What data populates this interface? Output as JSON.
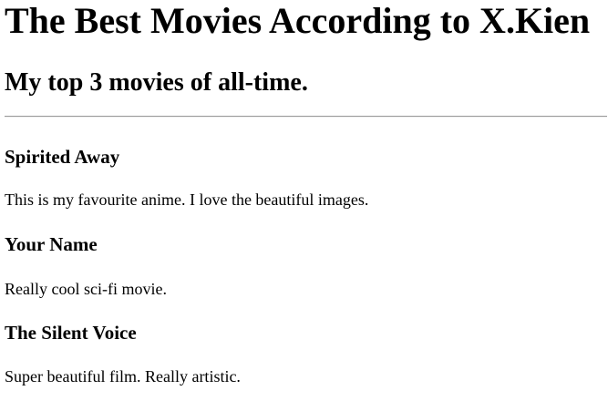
{
  "page": {
    "title": "The Best Movies According to X.Kien",
    "subtitle": "My top 3 movies of all-time."
  },
  "movies": [
    {
      "title": "Spirited Away",
      "description": "This is my favourite anime. I love the beautiful images."
    },
    {
      "title": "Your Name",
      "description": "Really cool sci-fi movie."
    },
    {
      "title": "The Silent Voice",
      "description": "Super beautiful film. Really artistic."
    }
  ]
}
